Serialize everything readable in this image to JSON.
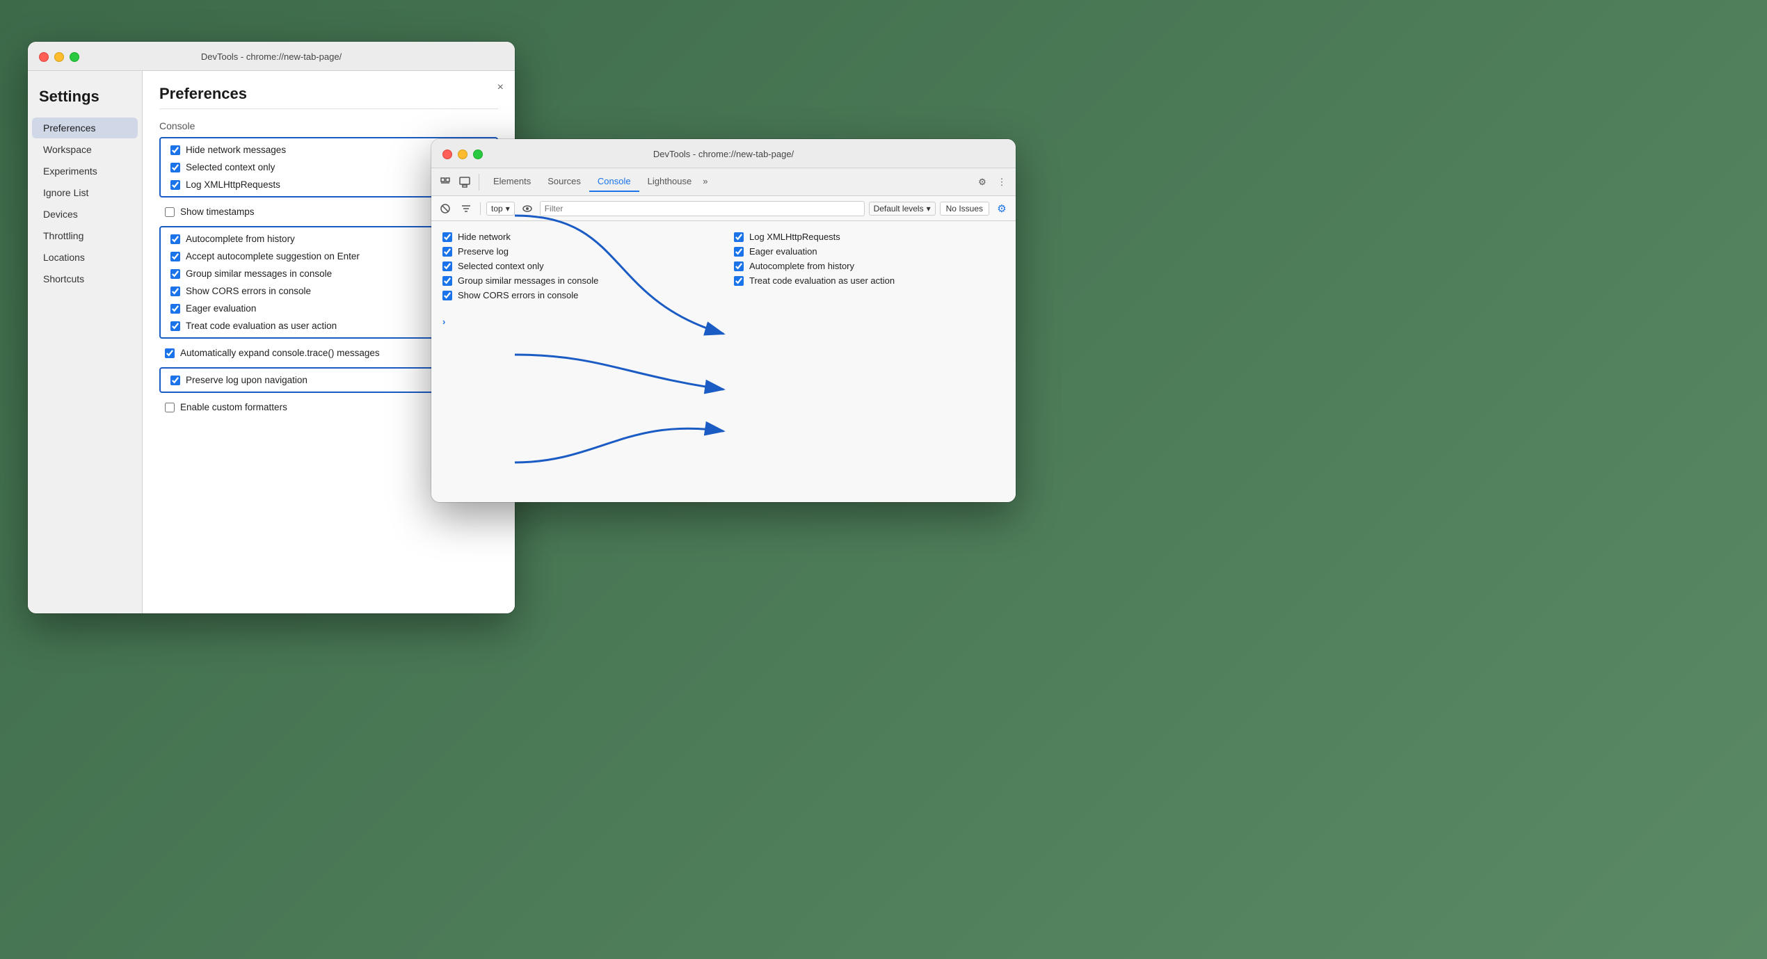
{
  "background": {
    "color": "#4a7c59"
  },
  "settings_window": {
    "title": "DevTools - chrome://new-tab-page/",
    "close_label": "×",
    "sidebar": {
      "heading": "Settings",
      "items": [
        {
          "id": "preferences",
          "label": "Preferences",
          "active": true
        },
        {
          "id": "workspace",
          "label": "Workspace",
          "active": false
        },
        {
          "id": "experiments",
          "label": "Experiments",
          "active": false
        },
        {
          "id": "ignore-list",
          "label": "Ignore List",
          "active": false
        },
        {
          "id": "devices",
          "label": "Devices",
          "active": false
        },
        {
          "id": "throttling",
          "label": "Throttling",
          "active": false
        },
        {
          "id": "locations",
          "label": "Locations",
          "active": false
        },
        {
          "id": "shortcuts",
          "label": "Shortcuts",
          "active": false
        }
      ]
    },
    "content": {
      "title": "Preferences",
      "section_console": "Console",
      "checkboxes_group1": [
        {
          "id": "hide-network",
          "label": "Hide network messages",
          "checked": true
        },
        {
          "id": "selected-context",
          "label": "Selected context only",
          "checked": true
        },
        {
          "id": "log-xmlhttp",
          "label": "Log XMLHttpRequests",
          "checked": true
        }
      ],
      "checkbox_timestamps": {
        "id": "show-timestamps",
        "label": "Show timestamps",
        "checked": false
      },
      "checkboxes_group2": [
        {
          "id": "autocomplete-history",
          "label": "Autocomplete from history",
          "checked": true
        },
        {
          "id": "accept-autocomplete",
          "label": "Accept autocomplete suggestion on Enter",
          "checked": true
        },
        {
          "id": "group-similar",
          "label": "Group similar messages in console",
          "checked": true
        },
        {
          "id": "show-cors",
          "label": "Show CORS errors in console",
          "checked": true
        },
        {
          "id": "eager-eval",
          "label": "Eager evaluation",
          "checked": true
        },
        {
          "id": "treat-code-eval",
          "label": "Treat code evaluation as user action",
          "checked": true
        }
      ],
      "checkbox_expand_trace": {
        "id": "expand-trace",
        "label": "Automatically expand console.trace() messages",
        "checked": true
      },
      "checkbox_preserve_log": {
        "id": "preserve-log",
        "label": "Preserve log upon navigation",
        "checked": true
      },
      "checkbox_custom_formatters": {
        "id": "custom-formatters",
        "label": "Enable custom formatters",
        "checked": false
      }
    }
  },
  "devtools_window": {
    "title": "DevTools - chrome://new-tab-page/",
    "tabs": [
      {
        "id": "elements",
        "label": "Elements",
        "active": false
      },
      {
        "id": "sources",
        "label": "Sources",
        "active": false
      },
      {
        "id": "console",
        "label": "Console",
        "active": true
      },
      {
        "id": "lighthouse",
        "label": "Lighthouse",
        "active": false
      },
      {
        "id": "more",
        "label": "»",
        "active": false
      }
    ],
    "toolbar": {
      "top_label": "top",
      "filter_placeholder": "Filter",
      "levels_label": "Default levels",
      "no_issues_label": "No Issues"
    },
    "console_items_col1": [
      {
        "id": "hide-network",
        "label": "Hide network",
        "checked": true
      },
      {
        "id": "preserve-log",
        "label": "Preserve log",
        "checked": true
      },
      {
        "id": "selected-context",
        "label": "Selected context only",
        "checked": true
      },
      {
        "id": "group-similar",
        "label": "Group similar messages in console",
        "checked": true
      },
      {
        "id": "show-cors",
        "label": "Show CORS errors in console",
        "checked": true
      }
    ],
    "console_items_col2": [
      {
        "id": "log-xmlhttp",
        "label": "Log XMLHttpRequests",
        "checked": true
      },
      {
        "id": "eager-eval",
        "label": "Eager evaluation",
        "checked": true
      },
      {
        "id": "autocomplete-history",
        "label": "Autocomplete from history",
        "checked": true
      },
      {
        "id": "treat-code-eval",
        "label": "Treat code evaluation as user action",
        "checked": true
      }
    ]
  }
}
